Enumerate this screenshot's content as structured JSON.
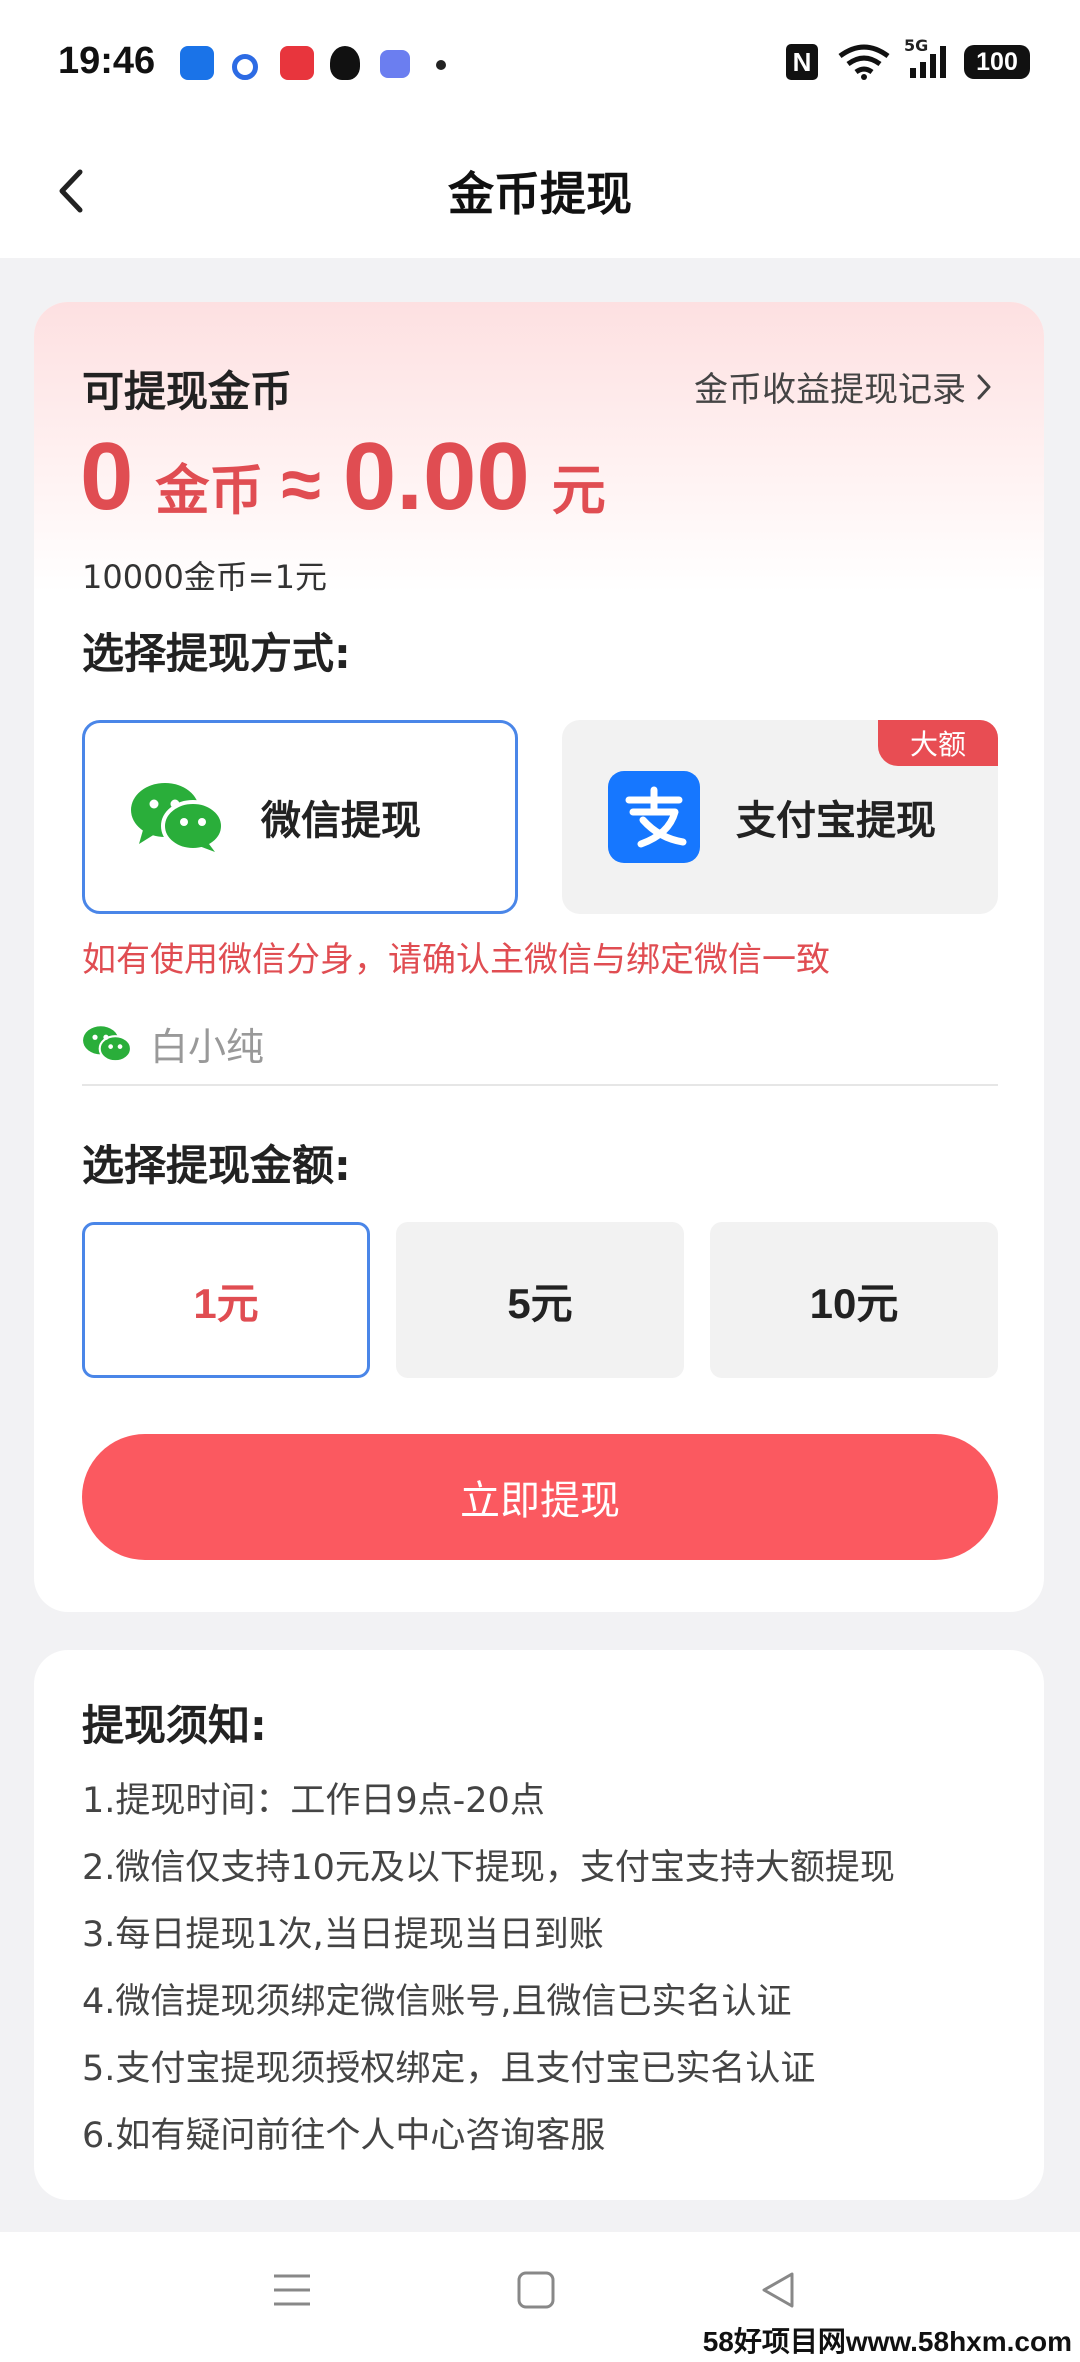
{
  "status_bar": {
    "time": "19:46",
    "battery": "100",
    "network": "5G",
    "app_icons": [
      "fan-app-icon",
      "circle-app-icon",
      "music-app-icon",
      "qq-penguin-icon",
      "message-app-icon"
    ]
  },
  "header": {
    "title": "金币提现",
    "back_icon": "chevron-left-icon"
  },
  "balance": {
    "label": "可提现金币",
    "record_link": "金币收益提现记录",
    "coins": "0",
    "coin_unit": "金币",
    "approx": "≈",
    "yuan": "0.00",
    "yuan_unit": "元",
    "rate": "10000金币=1元"
  },
  "method": {
    "section_title": "选择提现方式:",
    "wechat_label": "微信提现",
    "alipay_label": "支付宝提现",
    "alipay_badge": "大额",
    "selected": "wechat",
    "warning": "如有使用微信分身，请确认主微信与绑定微信一致",
    "wechat_name": "白小纯"
  },
  "amount": {
    "section_title": "选择提现金额:",
    "options": [
      "1元",
      "5元",
      "10元"
    ],
    "selected_index": 0
  },
  "submit_label": "立即提现",
  "notice": {
    "title": "提现须知:",
    "items": [
      "1.提现时间：工作日9点-20点",
      "2.微信仅支持10元及以下提现，支付宝支持大额提现",
      "3.每日提现1次,当日提现当日到账",
      "4.微信提现须绑定微信账号,且微信已实名认证",
      "5.支付宝提现须授权绑定，且支付宝已实名认证",
      "6.如有疑问前往个人中心咨询客服"
    ]
  },
  "watermark": "58好项目网www.58hxm.com",
  "colors": {
    "accent_red": "#e04d52",
    "button_red": "#fb5960",
    "select_blue": "#4a86e8",
    "wechat_green": "#2aae3a",
    "alipay_blue": "#1677ff"
  }
}
